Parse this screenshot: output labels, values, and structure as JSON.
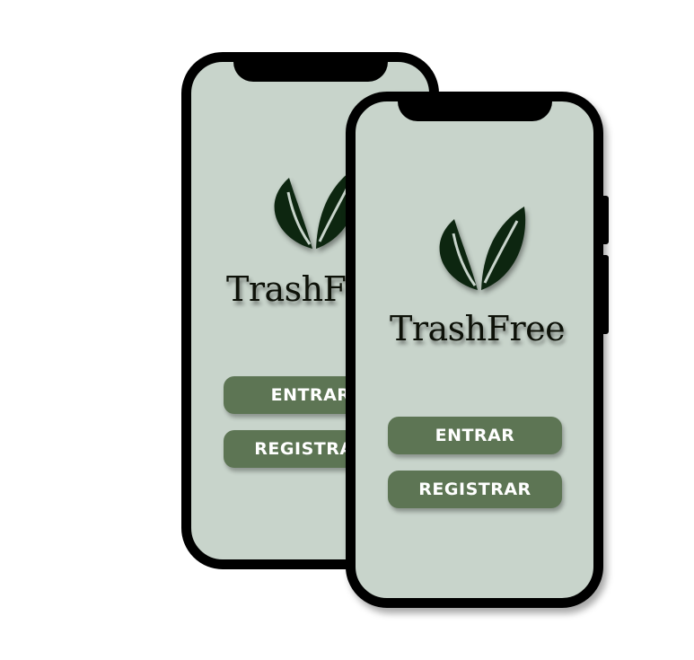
{
  "app": {
    "name": "TrashFree",
    "login_label": "ENTRAR",
    "register_label": "REGISTRAR"
  },
  "colors": {
    "screen_background": "#c8d4cb",
    "button_fill": "#5d7554",
    "leaf_color": "#0d2610",
    "frame": "#000000"
  },
  "icons": {
    "logo": "leaves-icon"
  }
}
